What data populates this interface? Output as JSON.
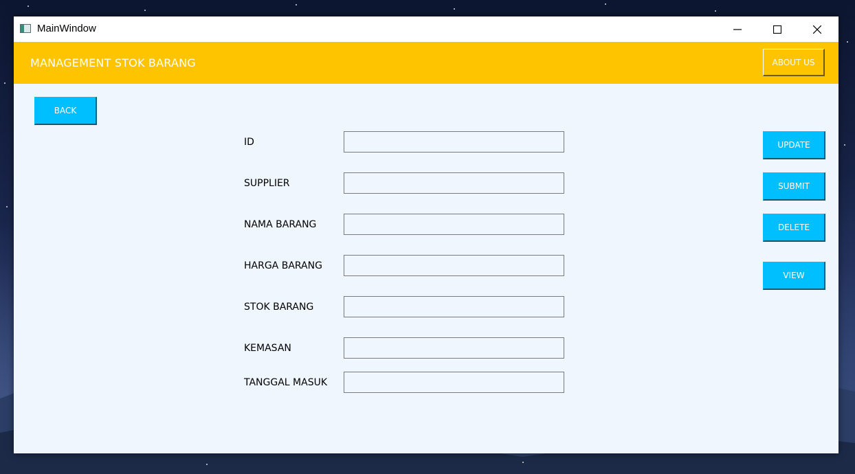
{
  "window": {
    "title": "MainWindow"
  },
  "header": {
    "title": "MANAGEMENT STOK BARANG",
    "about_label": "ABOUT US"
  },
  "back_label": "BACK",
  "form": {
    "fields": [
      {
        "label": "ID",
        "value": ""
      },
      {
        "label": "SUPPLIER",
        "value": ""
      },
      {
        "label": "NAMA BARANG",
        "value": ""
      },
      {
        "label": "HARGA BARANG",
        "value": ""
      },
      {
        "label": "STOK BARANG",
        "value": ""
      },
      {
        "label": "KEMASAN",
        "value": ""
      },
      {
        "label": "TANGGAL MASUK",
        "value": ""
      }
    ]
  },
  "actions": {
    "update_label": "UPDATE",
    "submit_label": "SUBMIT",
    "delete_label": "DELETE",
    "view_label": "VIEW"
  },
  "colors": {
    "header_bg": "#fec400",
    "button_bg": "#00bfff",
    "content_bg": "#eff6fd"
  },
  "icons": {
    "app": "app-window-icon",
    "minimize": "minimize-icon",
    "maximize": "maximize-icon",
    "close": "close-icon"
  }
}
